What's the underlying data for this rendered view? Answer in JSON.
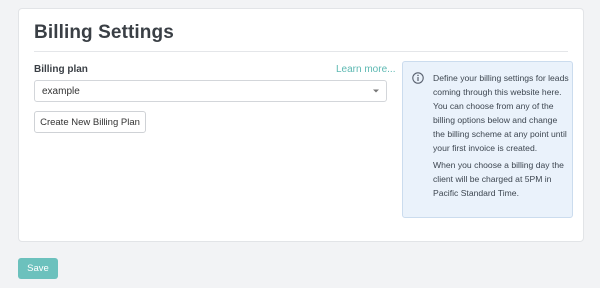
{
  "page": {
    "title": "Billing Settings"
  },
  "billing_plan": {
    "label": "Billing plan",
    "learn_more": "Learn more...",
    "selected": "example",
    "create_button": "Create New Billing Plan"
  },
  "info": {
    "paragraph_1": "Define your billing settings for leads coming through this website here. You can choose from any of the billing options below and change the billing scheme at any point until your first invoice is created.",
    "paragraph_2": "When you choose a billing day the client will be charged at 5PM in Pacific Standard Time."
  },
  "footer": {
    "save_label": "Save"
  },
  "colors": {
    "accent": "#6cc1bd",
    "link": "#5cb8b2",
    "info_bg": "#eaf2fb",
    "info_icon": "#5a6270"
  }
}
